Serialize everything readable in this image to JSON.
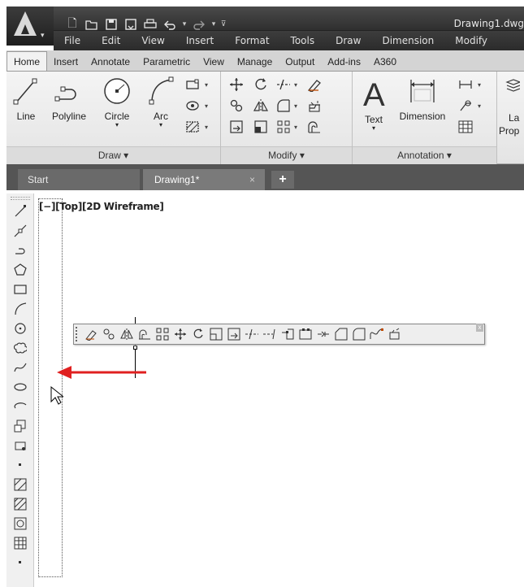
{
  "title_bar": {
    "document_name": "Drawing1.dwg",
    "quick_access": [
      "new-icon",
      "open-icon",
      "save-icon",
      "save-as-icon",
      "plot-icon",
      "undo-icon",
      "redo-icon",
      "customize-qat-icon"
    ]
  },
  "menu_bar": {
    "items": [
      "File",
      "Edit",
      "View",
      "Insert",
      "Format",
      "Tools",
      "Draw",
      "Dimension",
      "Modify"
    ]
  },
  "ribbon_tabs": {
    "items": [
      "Home",
      "Insert",
      "Annotate",
      "Parametric",
      "View",
      "Manage",
      "Output",
      "Add-ins",
      "A360"
    ],
    "active": "Home"
  },
  "ribbon": {
    "draw": {
      "title": "Draw ▾",
      "line": "Line",
      "polyline": "Polyline",
      "circle": "Circle",
      "arc": "Arc"
    },
    "modify": {
      "title": "Modify ▾"
    },
    "annotation": {
      "title": "Annotation ▾",
      "text": "Text",
      "dimension": "Dimension"
    },
    "layers": {
      "partial_label_1": "La",
      "partial_label_2": "Prop"
    }
  },
  "doc_tabs": {
    "start": "Start",
    "drawing": "Drawing1*",
    "close": "×",
    "add": "+"
  },
  "viewport": {
    "label": "[−][Top][2D Wireframe]"
  },
  "colors": {
    "arrow": "#e02020",
    "title_bar": "#3a3a3a",
    "ribbon": "#ececec"
  }
}
